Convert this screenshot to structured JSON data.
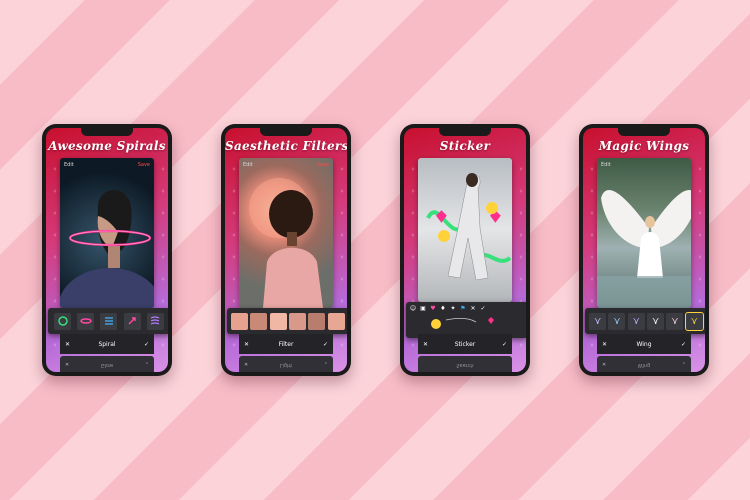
{
  "phones": [
    {
      "title": "Awesome Spirals",
      "edit_label": "Edit",
      "save_label": "Save",
      "tool_label": "Spiral",
      "secondary_label": "Glow",
      "icons": [
        "ring-green-icon",
        "ring-pink-icon",
        "coil-blue-icon",
        "arrow-pink-icon",
        "coil-purple-icon"
      ]
    },
    {
      "title": "Saesthetic Filters",
      "edit_label": "Edit",
      "save_label": "Save",
      "tool_label": "Filter",
      "secondary_label": "Light",
      "filter_level": 0.7
    },
    {
      "title": "Sticker",
      "tool_label": "Sticker",
      "secondary_label": "Search"
    },
    {
      "title": "Magic Wings",
      "edit_label": "Edit",
      "tool_label": "Wing",
      "secondary_label": "Wing"
    }
  ],
  "colors": {
    "bg_stripe_a": "#fbd3d9",
    "bg_stripe_b": "#f7bcc6",
    "screen_red": "#c8102e",
    "screen_purple": "#b66ad8",
    "save_red": "#ff4a4a",
    "toolbar_dark": "#2b2b2f"
  }
}
